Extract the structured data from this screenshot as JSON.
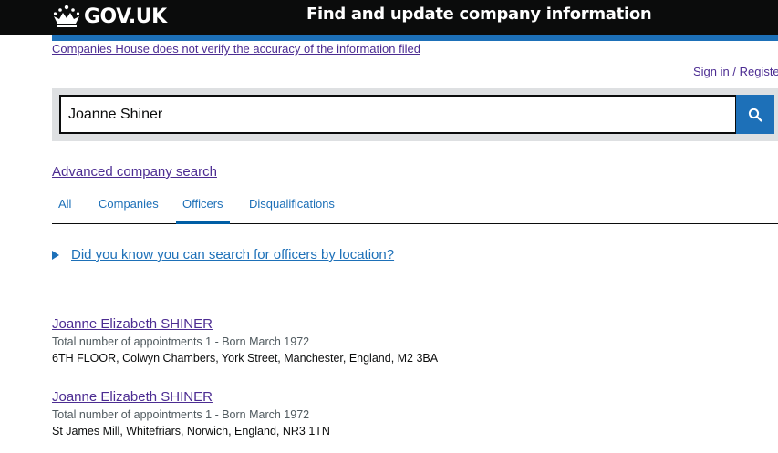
{
  "header": {
    "logo_text": "GOV.UK",
    "service_name": "Find and update company information"
  },
  "disclaimer": "Companies House does not verify the accuracy of the information filed",
  "signin": "Sign in / Registe",
  "search": {
    "value": "Joanne Shiner",
    "button_icon": "search-icon"
  },
  "advanced_search": "Advanced company search",
  "tabs": [
    {
      "label": "All",
      "active": false
    },
    {
      "label": "Companies",
      "active": false
    },
    {
      "label": "Officers",
      "active": true
    },
    {
      "label": "Disqualifications",
      "active": false
    }
  ],
  "details_prompt": "Did you know you can search for officers by location?",
  "results": [
    {
      "name": "Joanne Elizabeth SHINER",
      "meta": "Total number of appointments 1 - Born March 1972",
      "address": "6TH FLOOR, Colwyn Chambers, York Street, Manchester, England, M2 3BA"
    },
    {
      "name": "Joanne Elizabeth SHINER",
      "meta": "Total number of appointments 1 - Born March 1972",
      "address": "St James Mill, Whitefriars, Norwich, England, NR3 1TN"
    }
  ],
  "colors": {
    "header_bg": "#0b0c0c",
    "brand_blue": "#1d70b8",
    "visited_link": "#4c2c92",
    "panel_grey": "#dee0e2",
    "secondary_text": "#505a5f"
  }
}
